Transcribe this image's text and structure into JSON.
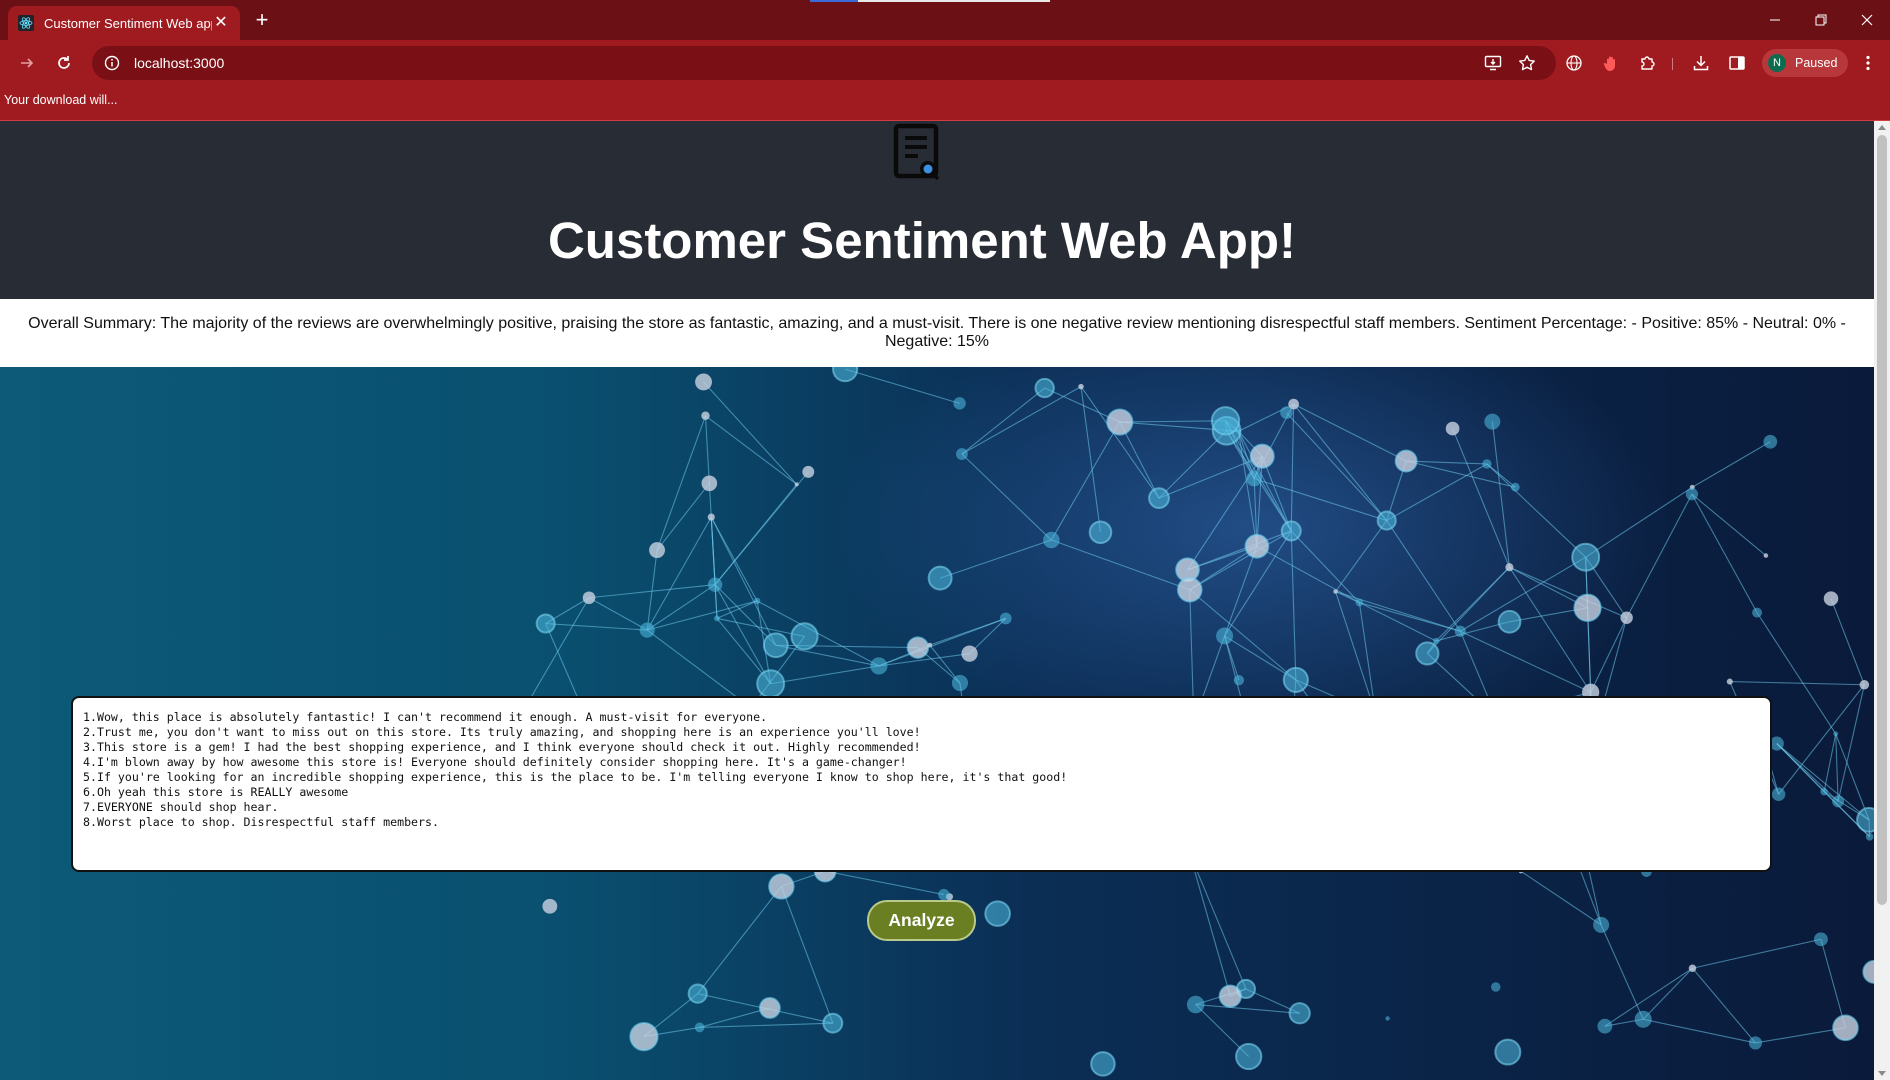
{
  "browser": {
    "tab_title": "Customer Sentiment Web app",
    "url": "localhost:3000",
    "profile_initial": "N",
    "profile_status": "Paused",
    "infobar_text": "Your download will..."
  },
  "app": {
    "title": "Customer Sentiment Web App!",
    "summary": "Overall Summary: The majority of the reviews are overwhelmingly positive, praising the store as fantastic, amazing, and a must-visit. There is one negative review mentioning disrespectful staff members. Sentiment Percentage: - Positive: 85% - Neutral: 0% - Negative: 15%",
    "reviews_value": "1.Wow, this place is absolutely fantastic! I can't recommend it enough. A must-visit for everyone.\n2.Trust me, you don't want to miss out on this store. Its truly amazing, and shopping here is an experience you'll love!\n3.This store is a gem! I had the best shopping experience, and I think everyone should check it out. Highly recommended!\n4.I'm blown away by how awesome this store is! Everyone should definitely consider shopping here. It's a game-changer!\n5.If you're looking for an incredible shopping experience, this is the place to be. I'm telling everyone I know to shop here, it's that good!\n6.Oh yeah this store is REALLY awesome\n7.EVERYONE should shop hear.\n8.Worst place to shop. Disrespectful staff members.",
    "analyze_label": "Analyze"
  },
  "colors": {
    "chrome_dark": "#6b1015",
    "chrome": "#a01b20",
    "header_bg": "#282c34",
    "analyze_button": "#6a7f22"
  }
}
